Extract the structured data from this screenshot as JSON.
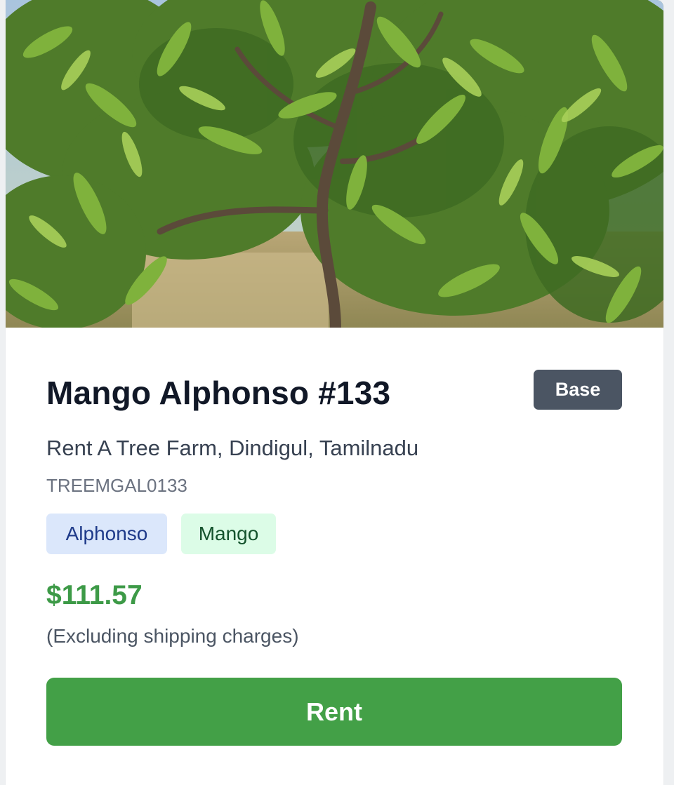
{
  "product": {
    "image_alt": "Mango tree with green leaves in a field",
    "title": "Mango Alphonso #133",
    "badge": "Base",
    "location": "Rent A Tree Farm, Dindigul, Tamilnadu",
    "code": "TREEMGAL0133",
    "tags": [
      {
        "label": "Alphonso"
      },
      {
        "label": "Mango"
      }
    ],
    "price": "$111.57",
    "price_note": "(Excluding shipping charges)",
    "rent_label": "Rent"
  },
  "colors": {
    "price": "#3d9a47",
    "rent_button": "#43a047",
    "badge": "#4b5563",
    "variety_tag_bg": "#dbe7fb",
    "fruit_tag_bg": "#dcfce7"
  }
}
